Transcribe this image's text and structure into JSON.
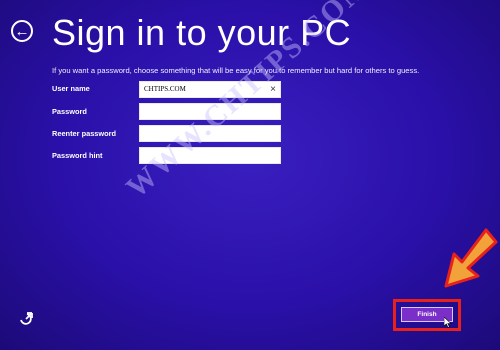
{
  "header": {
    "title": "Sign in to your PC",
    "back_icon": "back-arrow-icon"
  },
  "instructions": "If you want a password, choose something that will be easy for you to remember but hard for others to guess.",
  "form": {
    "fields": [
      {
        "label": "User name",
        "value": "CHTIPS.COM"
      },
      {
        "label": "Password",
        "value": ""
      },
      {
        "label": "Reenter password",
        "value": ""
      },
      {
        "label": "Password hint",
        "value": ""
      }
    ]
  },
  "watermark": "WWW.CHTIPS.COM",
  "finish_label": "Finish",
  "colors": {
    "background": "#2a10a8",
    "finish_button": "#7a2fc8",
    "highlight": "#e8221a"
  }
}
